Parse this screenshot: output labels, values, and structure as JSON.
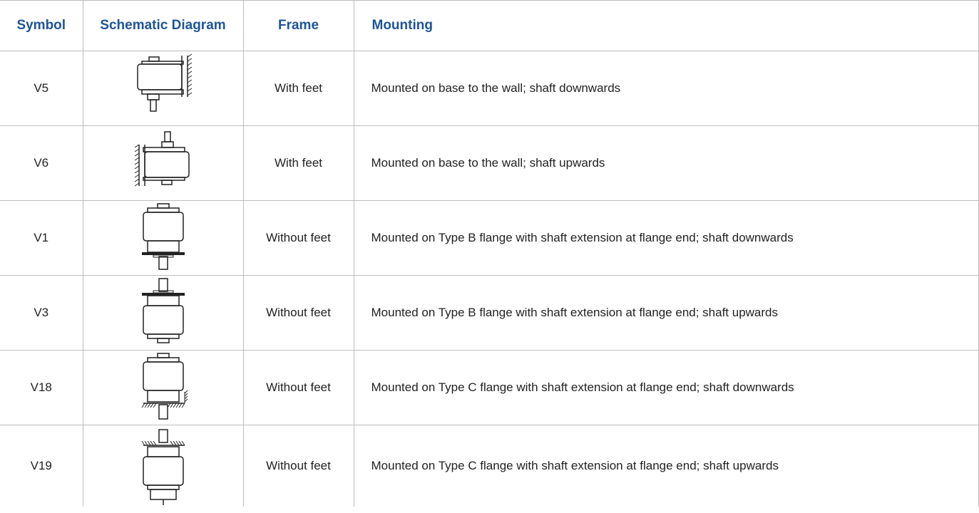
{
  "headers": {
    "symbol": "Symbol",
    "diagram": "Schematic Diagram",
    "frame": "Frame",
    "mounting": "Mounting"
  },
  "rows": [
    {
      "symbol": "V5",
      "frame": "With feet",
      "mounting": "Mounted on base to the wall; shaft downwards",
      "diagram_icon": "wall-mount-shaft-down-icon"
    },
    {
      "symbol": "V6",
      "frame": "With feet",
      "mounting": "Mounted on base to the wall; shaft upwards",
      "diagram_icon": "wall-mount-shaft-up-icon"
    },
    {
      "symbol": "V1",
      "frame": "Without feet",
      "mounting": "Mounted on Type B flange with shaft extension at flange end; shaft downwards",
      "diagram_icon": "flange-b-shaft-down-icon"
    },
    {
      "symbol": "V3",
      "frame": "Without feet",
      "mounting": "Mounted on Type B flange with shaft extension at flange end; shaft upwards",
      "diagram_icon": "flange-b-shaft-up-icon"
    },
    {
      "symbol": "V18",
      "frame": "Without feet",
      "mounting": "Mounted on Type C flange with shaft extension at flange end; shaft downwards",
      "diagram_icon": "flange-c-shaft-down-icon"
    },
    {
      "symbol": "V19",
      "frame": "Without feet",
      "mounting": "Mounted on Type C flange with shaft extension at flange end; shaft upwards",
      "diagram_icon": "flange-c-shaft-up-icon"
    }
  ],
  "colors": {
    "header_text": "#1e5596",
    "border": "#bdbdbd",
    "body_text": "#222222"
  }
}
